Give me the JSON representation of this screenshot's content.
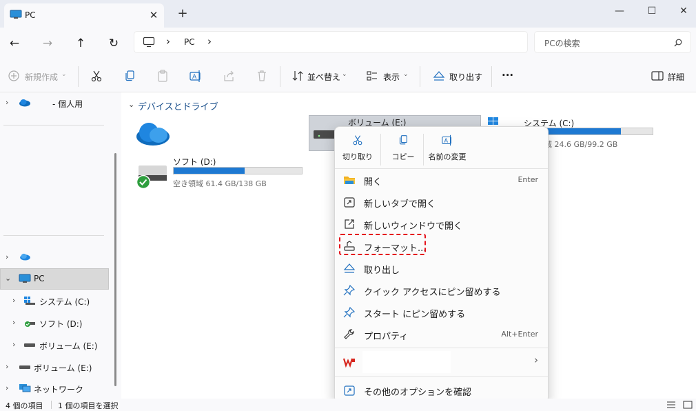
{
  "window": {
    "tab_title": "PC",
    "new_tab_glyph": "+",
    "close_tab_glyph": "✕",
    "minimize_glyph": "—",
    "maximize_glyph": "☐",
    "close_glyph": "✕"
  },
  "nav": {
    "back_glyph": "←",
    "forward_glyph": "→",
    "up_glyph": "↑",
    "refresh_glyph": "↻",
    "breadcrumb_sep": "›",
    "breadcrumb_item": "PC",
    "breadcrumb_trailing": "›",
    "search_placeholder": "PCの検索"
  },
  "commandbar": {
    "new_label": "新規作成",
    "sort_label": "並べ替え",
    "view_label": "表示",
    "eject_label": "取り出す",
    "more_glyph": "···",
    "details_label": "詳細"
  },
  "sidebar": {
    "onedrive_label": "- 個人用",
    "pc_label": "PC",
    "items": [
      {
        "label": "システム (C:)"
      },
      {
        "label": "ソフト (D:)"
      },
      {
        "label": "ボリューム (E:)"
      },
      {
        "label": "ボリューム (E:)"
      },
      {
        "label": "ネットワーク"
      }
    ]
  },
  "main": {
    "section_title": "デバイスとドライブ",
    "drives": [
      {
        "name": "ソフト (D:)",
        "free_text": "空き領域 61.4 GB/138 GB",
        "used_fraction": 0.555
      },
      {
        "name": "ボリューム (E:)"
      },
      {
        "name": "システム (C:)",
        "free_text": "域 24.6 GB/99.2 GB",
        "used_fraction": 0.75
      }
    ]
  },
  "context_menu": {
    "quick": [
      {
        "label": "切り取り",
        "icon": "scissors-icon"
      },
      {
        "label": "コピー",
        "icon": "copy-icon"
      },
      {
        "label": "名前の変更",
        "icon": "rename-icon"
      }
    ],
    "items": [
      {
        "label": "開く",
        "shortcut": "Enter"
      },
      {
        "label": "新しいタブで開く"
      },
      {
        "label": "新しいウィンドウで開く"
      },
      {
        "label": "フォーマット..."
      },
      {
        "label": "取り出し"
      },
      {
        "label": "クイック アクセスにピン留めする"
      },
      {
        "label": "スタート にピン留めする"
      },
      {
        "label": "プロパティ",
        "shortcut": "Alt+Enter"
      },
      {
        "label": ""
      },
      {
        "label": "その他のオプションを確認"
      }
    ],
    "submenu_glyph": "›"
  },
  "status": {
    "item_count": "4 個の項目",
    "selected": "1 個の項目を選択"
  },
  "colors": {
    "accent": "#1e79d2",
    "highlight": "#e5121b",
    "wps_red": "#d7261e"
  }
}
